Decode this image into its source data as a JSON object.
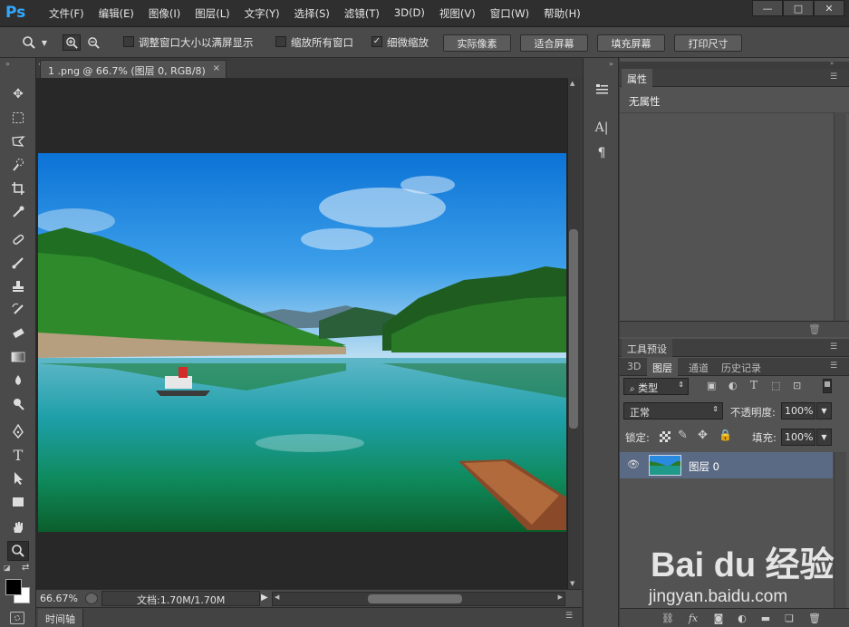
{
  "app": {
    "logo": "Ps"
  },
  "menu": [
    "文件(F)",
    "编辑(E)",
    "图像(I)",
    "图层(L)",
    "文字(Y)",
    "选择(S)",
    "滤镜(T)",
    "3D(D)",
    "视图(V)",
    "窗口(W)",
    "帮助(H)"
  ],
  "window_controls": {
    "minimize": "—",
    "maximize": "□",
    "close": "✕"
  },
  "options": {
    "resize_windows_label": "调整窗口大小以满屏显示",
    "resize_windows_checked": false,
    "zoom_all_label": "缩放所有窗口",
    "zoom_all_checked": false,
    "scrubby_zoom_label": "细微缩放",
    "scrubby_zoom_checked": true,
    "btn_actual_pixels": "实际像素",
    "btn_fit_screen": "适合屏幕",
    "btn_fill_screen": "填充屏幕",
    "btn_print_size": "打印尺寸"
  },
  "document": {
    "tab_title": "1 .png @ 66.7% (图层 0, RGB/8)",
    "zoom": "66.67%",
    "doc_info": "文档:1.70M/1.70M"
  },
  "timeline_label": "时间轴",
  "properties_panel": {
    "title": "属性",
    "content": "无属性"
  },
  "tool_presets_panel": {
    "title": "工具预设"
  },
  "layers_panel": {
    "tabs": [
      "3D",
      "图层",
      "通道",
      "历史记录"
    ],
    "active_tab": "图层",
    "filter_kind": "类型",
    "blend_mode": "正常",
    "opacity_label": "不透明度:",
    "opacity_value": "100%",
    "lock_label": "锁定:",
    "fill_label": "填充:",
    "fill_value": "100%",
    "layers": [
      {
        "name": "图层 0",
        "visible": true,
        "selected": true
      }
    ]
  },
  "watermark": {
    "brand": "Bai du 经验",
    "url": "jingyan.baidu.com"
  },
  "colors": {
    "accent": "#31a8ff",
    "selected_layer": "#5b6a84",
    "canvas_bg": "#282828"
  }
}
